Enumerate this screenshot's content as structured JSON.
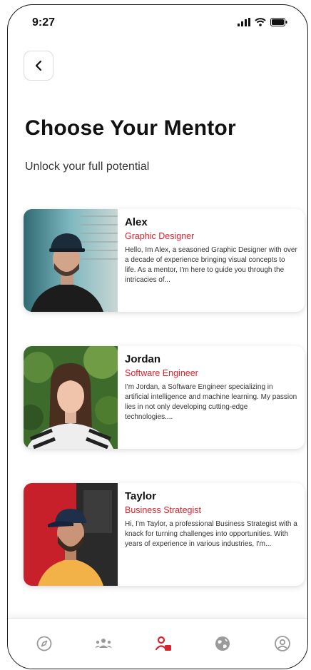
{
  "status_bar": {
    "time": "9:27"
  },
  "header": {
    "title": "Choose Your Mentor",
    "subtitle": "Unlock your full potential"
  },
  "mentors": [
    {
      "name": "Alex",
      "role": "Graphic Designer",
      "bio": "Hello, Im Alex, a seasoned Graphic Designer with over a decade of experience bringing visual concepts to life. As a mentor, I'm here to guide you through the intricacies of..."
    },
    {
      "name": "Jordan",
      "role": "Software Engineer",
      "bio": "I'm Jordan, a Software Engineer specializing in artificial intelligence and machine learning. My passion lies in not only developing cutting-edge technologies...."
    },
    {
      "name": "Taylor",
      "role": "Business Strategist",
      "bio": "Hi, I'm Taylor, a professional Business Strategist with a knack for turning challenges into opportunities. With years of experience in various industries, I'm..."
    }
  ],
  "nav": {
    "items": [
      "compass-icon",
      "community-icon",
      "mentors-icon",
      "globe-icon",
      "profile-icon"
    ],
    "active": "mentors-icon"
  },
  "colors": {
    "accent": "#d8222f",
    "text": "#111111",
    "inactive_icon": "#9a9a9a"
  }
}
